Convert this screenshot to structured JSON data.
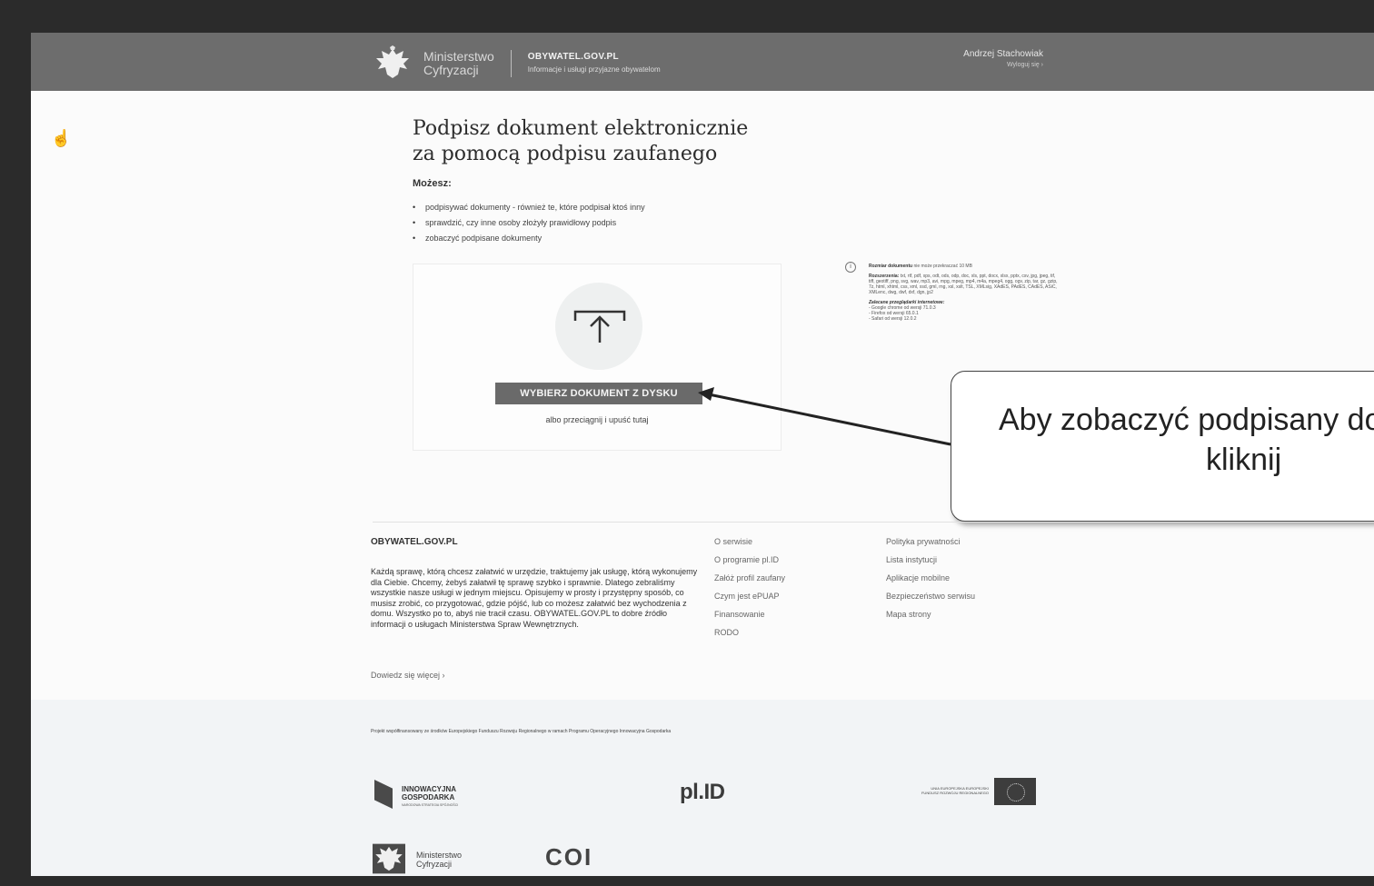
{
  "header": {
    "ministry_line1": "Ministerstwo",
    "ministry_line2": "Cyfryzacji",
    "site_name": "OBYWATEL.GOV.PL",
    "site_tagline": "Informacje i usługi przyjazne obywatelom",
    "user_name": "Andrzej Stachowiak",
    "logout_label": "Wyloguj się ›"
  },
  "main": {
    "title_line1": "Podpisz dokument elektronicznie",
    "title_line2": "za pomocą podpisu zaufanego",
    "can_label": "Możesz:",
    "bullets": [
      "podpisywać dokumenty - również te, które podpisał ktoś inny",
      "sprawdzić, czy inne osoby złożyły prawidłowy podpis",
      "zobaczyć podpisane dokumenty"
    ],
    "choose_button": "WYBIERZ DOKUMENT Z DYSKU",
    "drag_text": "albo przeciągnij i upuść tutaj"
  },
  "info": {
    "size_label": "Rozmiar dokumentu",
    "size_text": "nie może przekraczać 10 MB",
    "ext_label": "Rozszerzenia:",
    "ext_text": "txt, rtf, pdf, xps, odt, ods, odp, doc, xls, ppt, docx, xlsx, pptx, csv, jpg, jpeg, tif, tiff, geotiff, png, svg, wav, mp3, avi, mpg, mpeg, mp4, m4a, mpeg4, ogg, ogv, zip, tar, gz, gzip, 7z, html, xhtml, css, xml, xsd, gml, rng, xsl, xslt, TSL, XMLsig, XAdES, PAdES, CAdES, ASiC, XMLenc, dwg, dwf, dxf, dgn, jp2",
    "browsers_label": "Zalecane przeglądarki internetowe:",
    "browsers": [
      "- Google chrome od wersji 71.0.3",
      "- Firefox od wersji 65.0.1",
      "- Safari od wersji 12.0.2"
    ]
  },
  "callout": {
    "line1": "Aby zobaczyć podpisany do",
    "line2": "kliknij"
  },
  "footer": {
    "title": "OBYWATEL.GOV.PL",
    "text": "Każdą sprawę, którą chcesz załatwić w urzędzie, traktujemy jak usługę, którą wykonujemy dla Ciebie. Chcemy, żebyś załatwił tę sprawę szybko i sprawnie. Dlatego zebraliśmy wszystkie nasze usługi w jednym miejscu. Opisujemy w prosty i przystępny sposób, co musisz zrobić, co przygotować, gdzie pójść, lub co możesz załatwić bez wychodzenia z domu. Wszystko po to, abyś nie tracił czasu. OBYWATEL.GOV.PL to dobre źródło informacji o usługach Ministerstwa Spraw Wewnętrznych.",
    "learn_more": "Dowiedz się więcej ›",
    "links_col1": [
      "O serwisie",
      "O programie pl.ID",
      "Załóż profil zaufany",
      "Czym jest ePUAP",
      "Finansowanie",
      "RODO"
    ],
    "links_col2": [
      "Polityka prywatności",
      "Lista instytucji",
      "Aplikacje mobilne",
      "Bezpieczeństwo serwisu",
      "Mapa strony"
    ]
  },
  "funding": {
    "text": "Projekt współfinansowany ze środków Europejskiego Funduszu Rozwoju Regionalnego w ramach Programu Operacyjnego Innowacyjna Gospodarka",
    "ig_line1": "INNOWACYJNA",
    "ig_line2": "GOSPODARKA",
    "ig_sub": "NARODOWA STRATEGIA SPÓJNOŚCI",
    "plid": "pl.ID",
    "ue_text": "UNIA EUROPEJSKA EUROPEJSKI FUNDUSZ ROZWOJU REGIONALNEGO",
    "bottom_ministry1": "Ministerstwo",
    "bottom_ministry2": "Cyfryzacji",
    "coi": "COI"
  }
}
